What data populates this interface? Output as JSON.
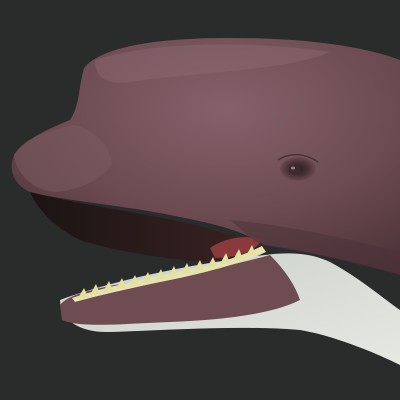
{
  "scene": {
    "background_color": "#2a2b2b",
    "subject": "whale-head-render",
    "palette": {
      "skin": "#6f4c52",
      "skin_dark": "#4f353a",
      "skin_light": "#84606a",
      "belly": "#d8dcd6",
      "mouth_interior": "#8a3a3a",
      "teeth": "#e3e0a0",
      "eye": "#3e2a2e"
    }
  }
}
